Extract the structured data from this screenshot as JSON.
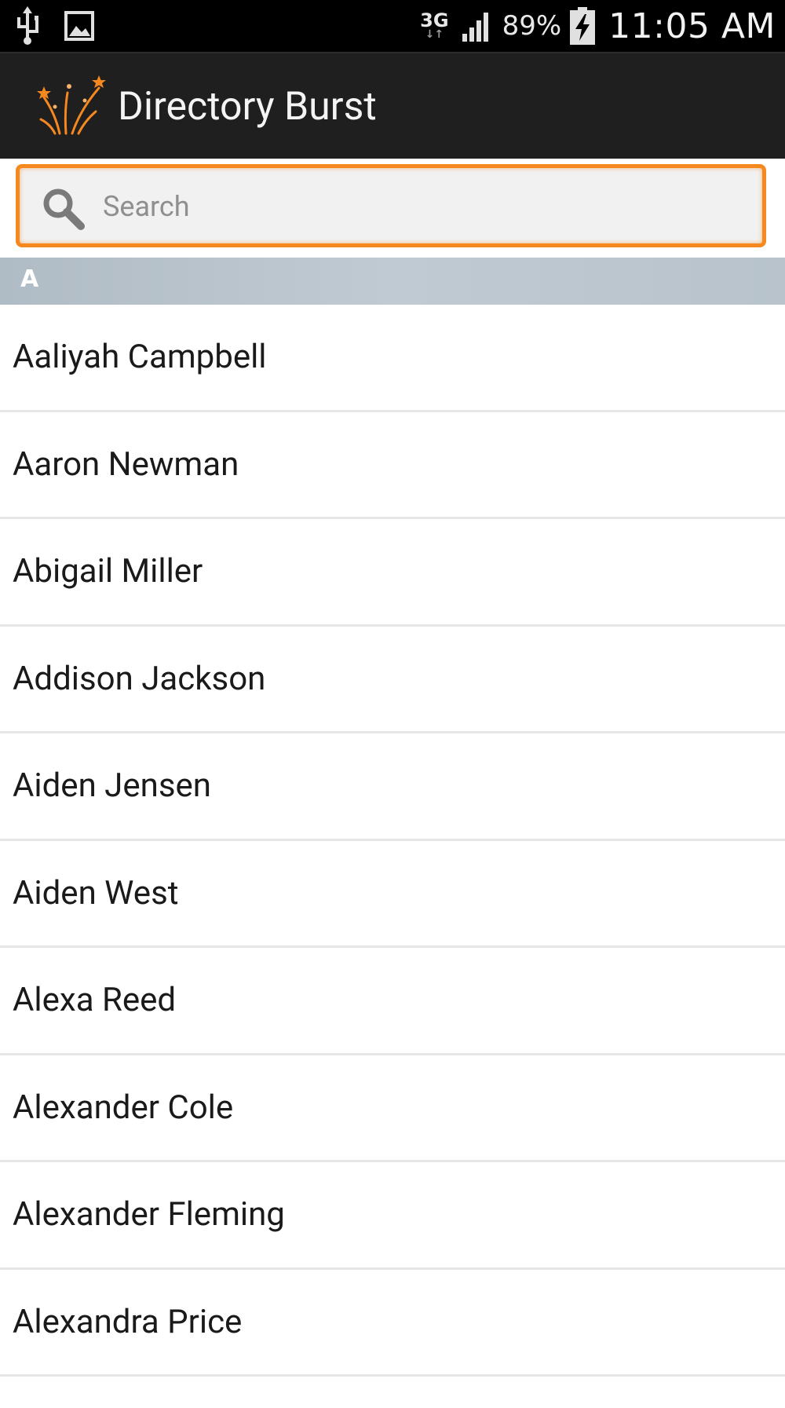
{
  "status_bar": {
    "icons_left": [
      "usb-icon",
      "image-notification-icon"
    ],
    "network_type": "3G",
    "network_arrows": "↓↑",
    "signal_icon": "signal-bars-icon",
    "battery_percent": "89%",
    "battery_icon": "battery-charging-icon",
    "time": "11:05 AM"
  },
  "app_bar": {
    "title": "Directory Burst",
    "logo_icon": "fireworks-logo-icon",
    "accent_color": "#f5881f"
  },
  "search": {
    "placeholder": "Search",
    "value": "",
    "icon": "search-icon"
  },
  "directory": {
    "section_letter": "A",
    "contacts": [
      "Aaliyah Campbell",
      "Aaron Newman",
      "Abigail Miller",
      "Addison Jackson",
      "Aiden Jensen",
      "Aiden West",
      "Alexa Reed",
      "Alexander Cole",
      "Alexander Fleming",
      "Alexandra Price"
    ]
  }
}
